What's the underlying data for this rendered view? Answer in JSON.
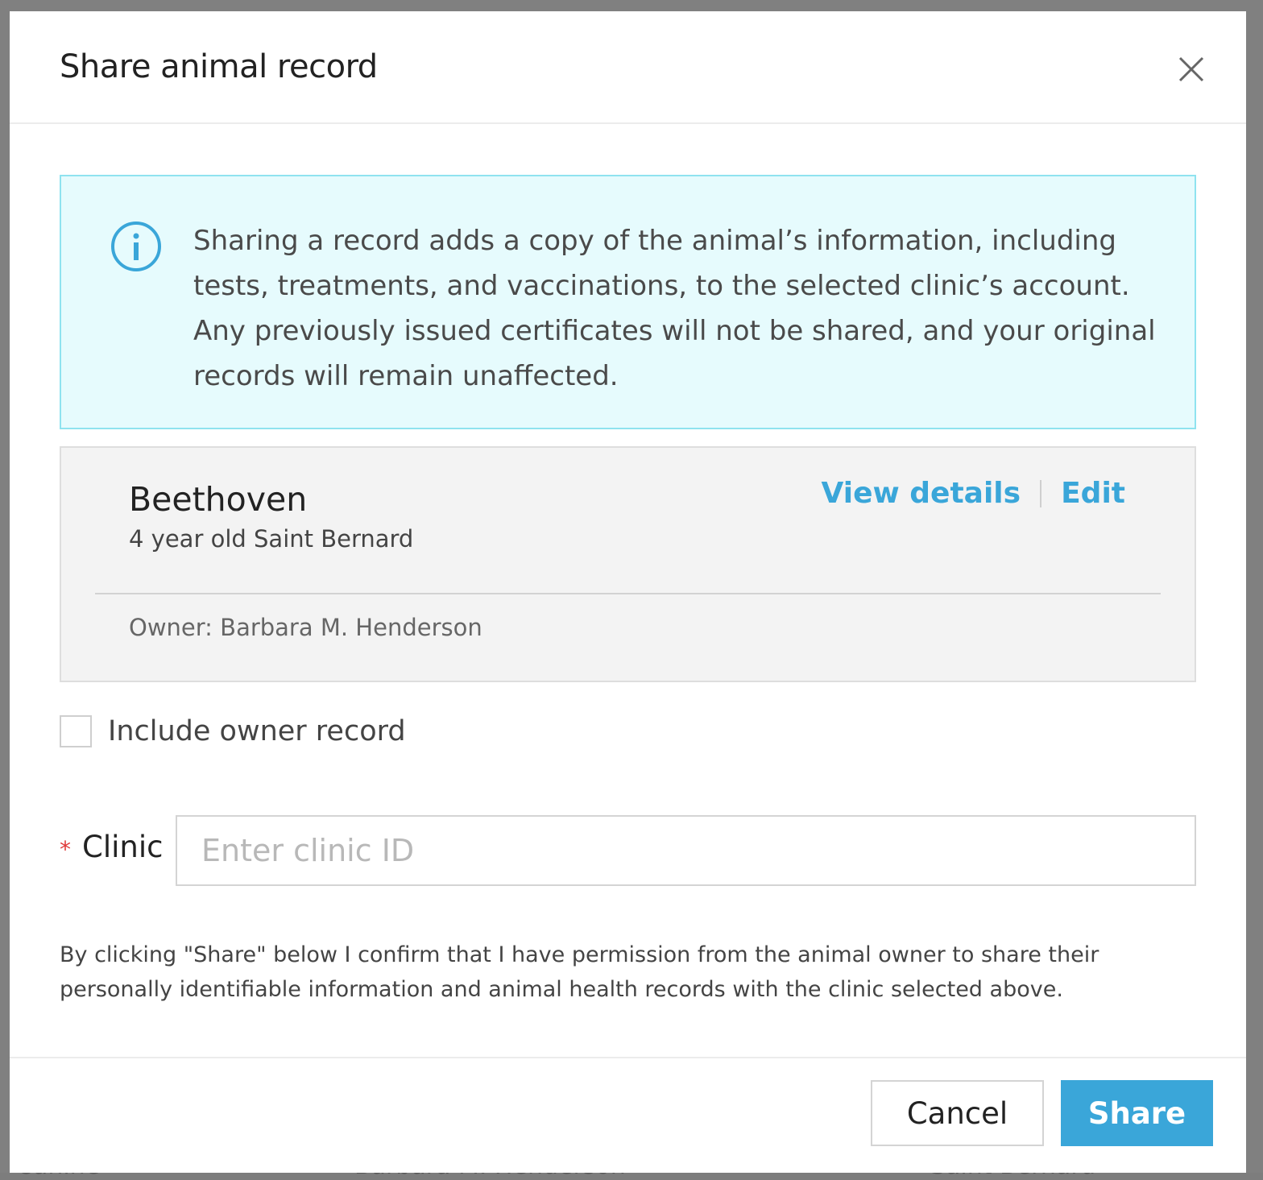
{
  "background": {
    "row_texts": [
      "Canine",
      "Barbara M. Henderson",
      "Saint Bernard"
    ]
  },
  "modal": {
    "title": "Share animal record",
    "close_icon": "close-icon"
  },
  "info": {
    "icon": "info-circle-icon",
    "text": "Sharing a record adds a copy of the animal’s information, including tests, treatments, and vaccinations, to the selected clinic’s account. Any previously issued certificates will not be shared, and your original records will remain unaffected."
  },
  "animal": {
    "name": "Beethoven",
    "description": "4 year old Saint Bernard",
    "owner": "Owner: Barbara M. Henderson",
    "view_details_label": "View details",
    "edit_label": "Edit"
  },
  "include_owner": {
    "label": "Include owner record",
    "checked": false
  },
  "clinic": {
    "required_mark": "*",
    "label": "Clinic",
    "value": "",
    "placeholder": "Enter clinic ID"
  },
  "consent": {
    "text": "By clicking \"Share\" below I confirm that I have permission from the animal owner to share their personally identifiable information and animal health records with the clinic selected above."
  },
  "footer": {
    "cancel_label": "Cancel",
    "share_label": "Share"
  },
  "colors": {
    "accent": "#3aa6d9",
    "info_bg": "#e6fbfd",
    "info_border": "#8fe3ef",
    "required": "#e03a3a"
  }
}
